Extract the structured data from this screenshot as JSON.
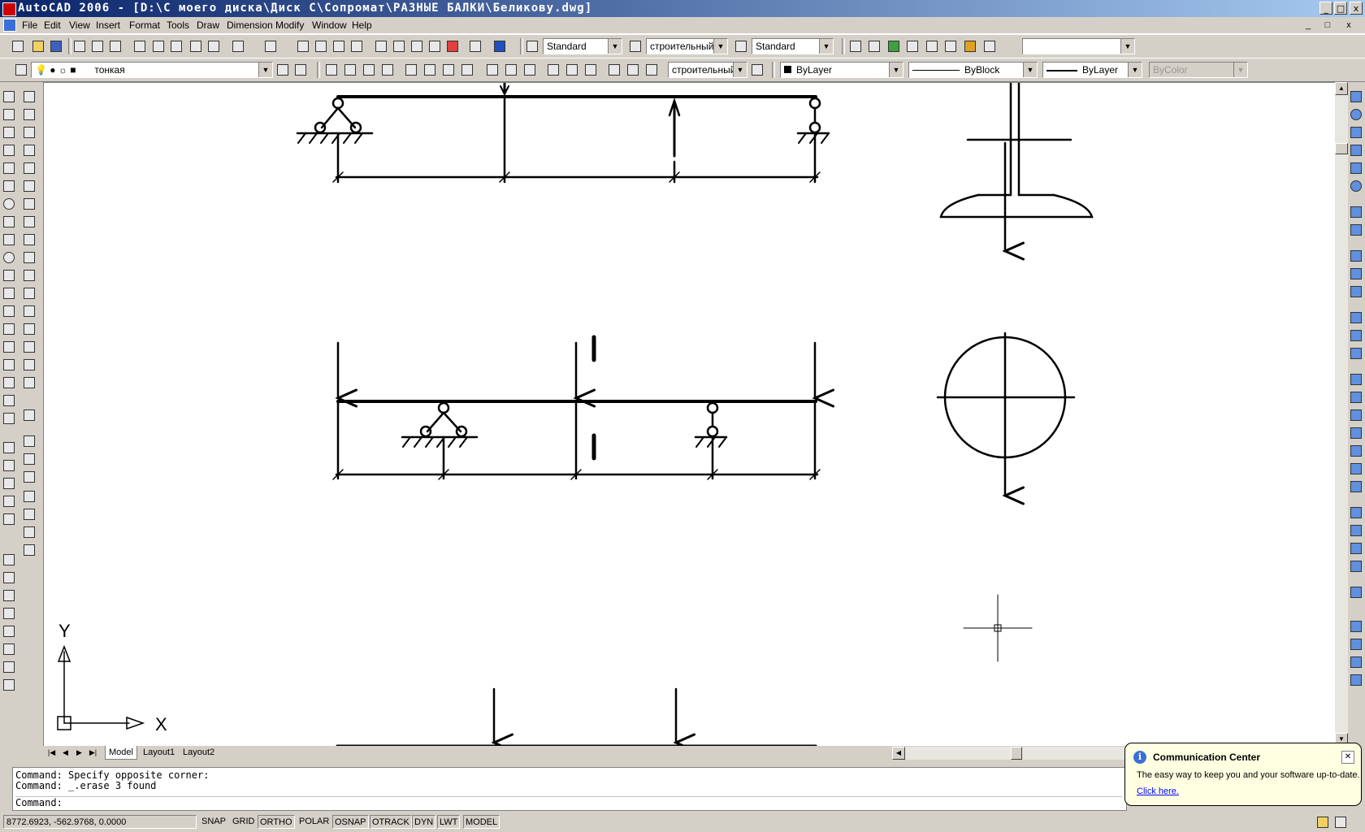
{
  "window": {
    "title": "AutoCAD 2006 - [D:\\С моего диска\\Диск С\\Сопромат\\РАЗНЫЕ БАЛКИ\\Беликову.dwg]",
    "min": "_",
    "max": "□",
    "close": "x"
  },
  "menu": {
    "items": [
      "File",
      "Edit",
      "View",
      "Insert",
      "Format",
      "Tools",
      "Draw",
      "Dimension",
      "Modify",
      "Window",
      "Help"
    ]
  },
  "toolbar_styles": {
    "text_style": "Standard",
    "dim_style": "строительный",
    "table_style": "Standard",
    "extra": ""
  },
  "toolbar_layers": {
    "layer": "тонкая",
    "dim_style2": "строительный",
    "color": "ByLayer",
    "linetype": "ByBlock",
    "lineweight": "ByLayer",
    "plotstyle": "ByColor"
  },
  "ucs": {
    "x_label": "X",
    "y_label": "Y"
  },
  "tabs": [
    "Model",
    "Layout1",
    "Layout2"
  ],
  "command": {
    "line1": "Command: Specify opposite corner:",
    "line2": "Command: _.erase 3 found",
    "prompt": "Command:"
  },
  "status": {
    "coords": "8772.6923, -562.9768, 0.0000",
    "buttons": [
      "SNAP",
      "GRID",
      "ORTHO",
      "POLAR",
      "OSNAP",
      "OTRACK",
      "DYN",
      "LWT",
      "MODEL"
    ]
  },
  "balloon": {
    "title": "Communication Center",
    "body": "The easy way to keep you and your software up-to-date.",
    "link": "Click here."
  },
  "colors": {
    "title_start": "#0a246a",
    "title_end": "#a6caf0",
    "face": "#d4d0c8",
    "canvas": "#ffffff",
    "balloon": "#ffffe1"
  }
}
